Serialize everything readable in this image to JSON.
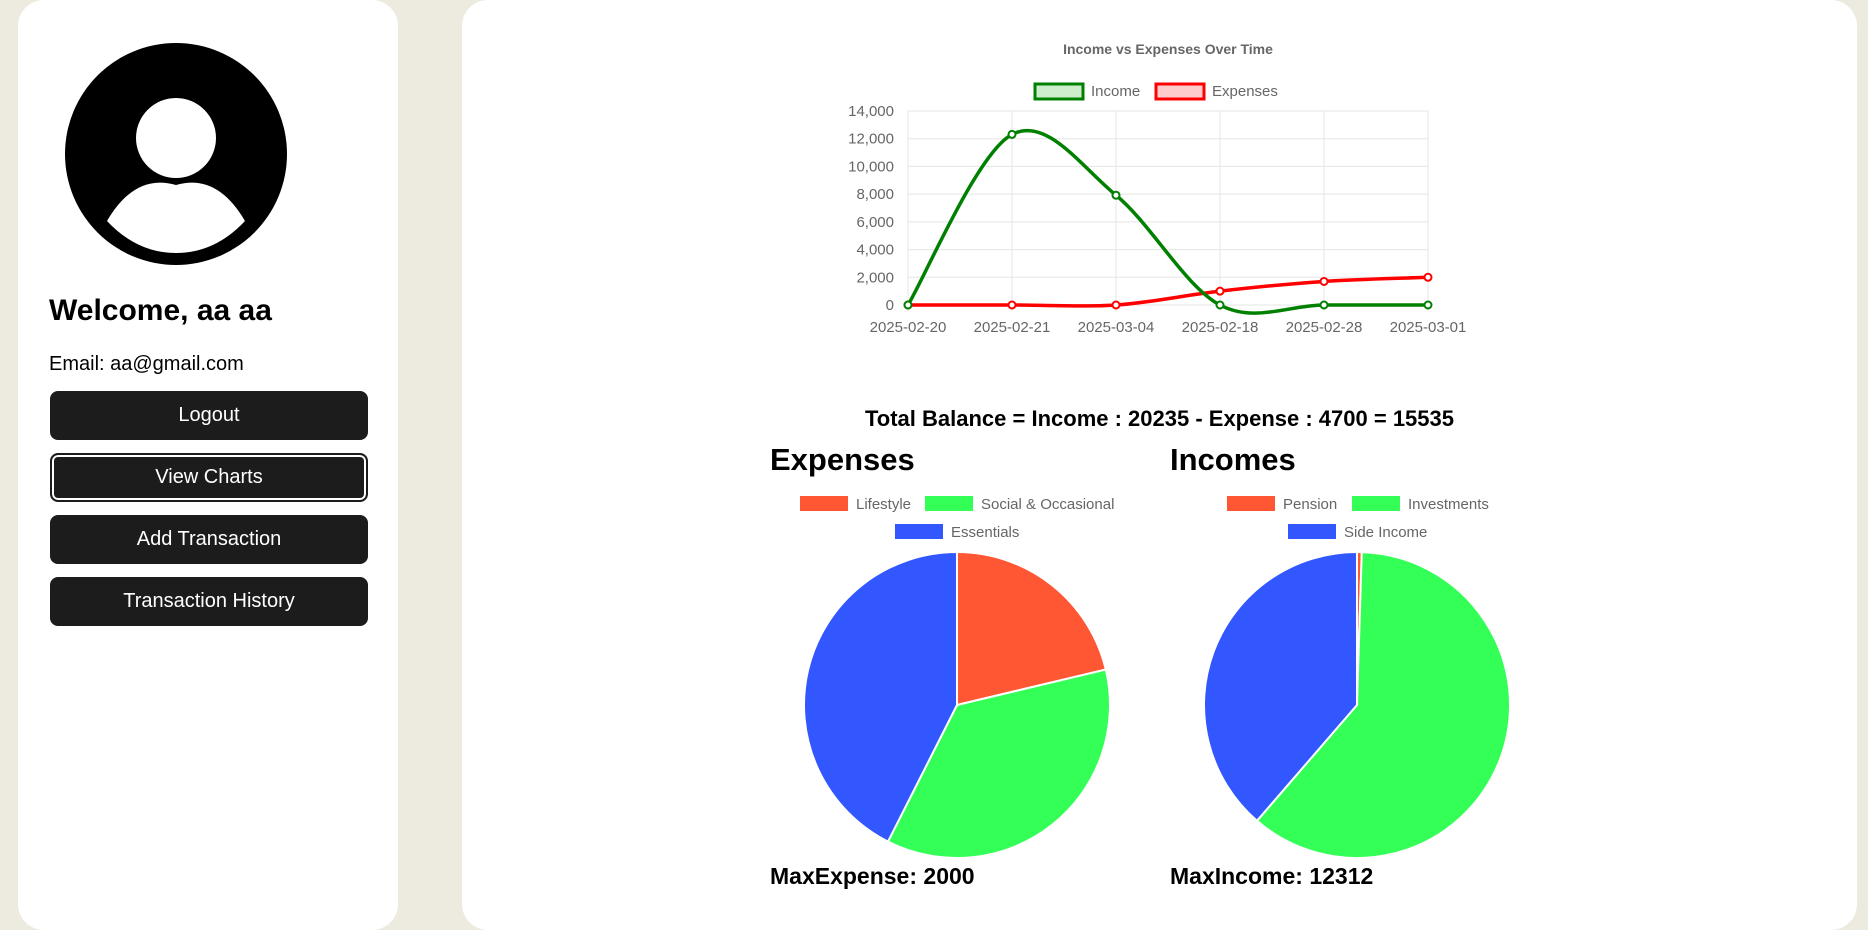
{
  "sidebar": {
    "welcome": "Welcome, aa aa",
    "email": "Email: aa@gmail.com",
    "buttons": {
      "logout": "Logout",
      "view_charts": "View Charts",
      "add_transaction": "Add Transaction",
      "transaction_history": "Transaction History"
    }
  },
  "main": {
    "balance_text": "Total Balance = Income : 20235 - Expense : 4700 = 15535",
    "expenses_title": "Expenses",
    "incomes_title": "Incomes",
    "max_expense": "MaxExpense: 2000",
    "max_income": "MaxIncome: 12312"
  },
  "chart_data": [
    {
      "type": "line",
      "title": "Income vs Expenses Over Time",
      "x": [
        "2025-02-20",
        "2025-02-21",
        "2025-03-04",
        "2025-02-18",
        "2025-02-28",
        "2025-03-01"
      ],
      "series": [
        {
          "name": "Income",
          "color": "#008000",
          "values": [
            0,
            12312,
            7923,
            0,
            0,
            0
          ]
        },
        {
          "name": "Expenses",
          "color": "#ff0000",
          "values": [
            0,
            0,
            0,
            1000,
            1700,
            2000
          ]
        }
      ],
      "ylim": [
        0,
        14000
      ],
      "yticks": [
        "0",
        "2,000",
        "4,000",
        "6,000",
        "8,000",
        "10,000",
        "12,000",
        "14,000"
      ],
      "grid": true,
      "legend": "top"
    },
    {
      "type": "pie",
      "categories": [
        "Lifestyle",
        "Social & Occasional",
        "Essentials"
      ],
      "values": [
        1000,
        1700,
        2000
      ],
      "colors": [
        "#ff5733",
        "#33ff57",
        "#3357ff"
      ],
      "legend": "top"
    },
    {
      "type": "pie",
      "categories": [
        "Pension",
        "Investments",
        "Side Income"
      ],
      "values": [
        100,
        12312,
        7823
      ],
      "colors": [
        "#ff5733",
        "#33ff57",
        "#3357ff"
      ],
      "legend": "top"
    }
  ]
}
